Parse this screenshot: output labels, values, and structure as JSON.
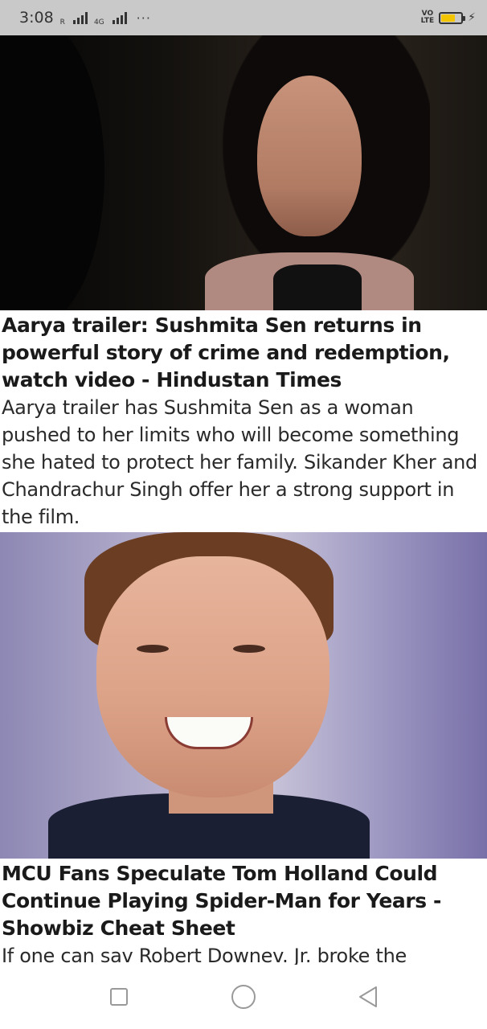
{
  "status_bar": {
    "time": "3:08",
    "signal_1_label": "R",
    "signal_2_label": "4G",
    "more": "···",
    "volte": [
      "VO",
      "LTE"
    ],
    "battery_level": 0.7,
    "battery_color": "#f2c500"
  },
  "feed": {
    "articles": [
      {
        "image_alt": "woman with dark hair and pink scarf",
        "headline": "Aarya trailer: Sushmita Sen returns in powerful story of crime and redemption, watch video - Hindustan Times",
        "summary": "Aarya trailer has Sushmita Sen as a woman pushed to her limits who will become something she hated to protect her family. Sikander Kher and Chandrachur Singh offer her a strong support in the film."
      },
      {
        "image_alt": "smiling young man",
        "headline": "MCU Fans Speculate Tom Holland Could Continue Playing Spider-Man for Years - Showbiz Cheat Sheet",
        "summary": "If one can sav Robert Downev. Jr. broke the"
      }
    ]
  },
  "nav_bar": {
    "recents_icon": "square-icon",
    "home_icon": "circle-icon",
    "back_icon": "triangle-back-icon"
  }
}
